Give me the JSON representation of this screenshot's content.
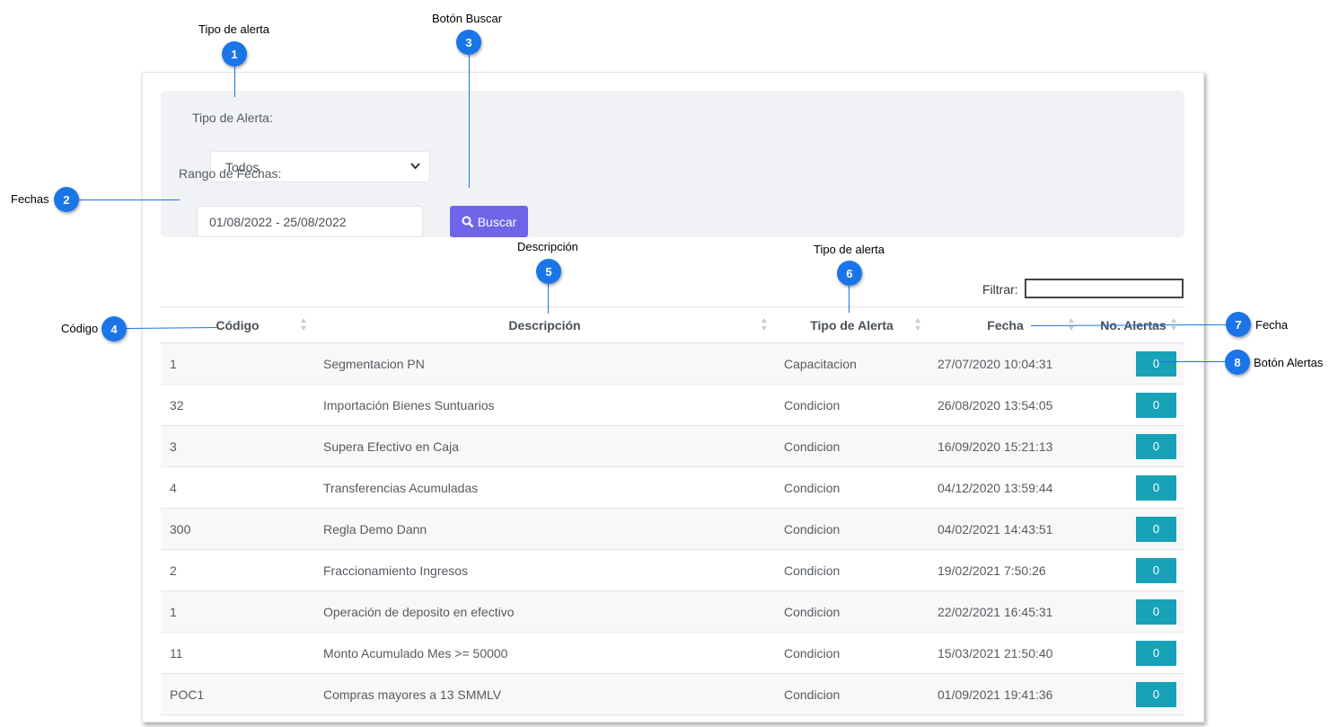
{
  "filters": {
    "tipo_label": "Tipo de Alerta:",
    "tipo_value": "Todos",
    "rango_label": "Rango de Fechas:",
    "rango_value": "01/08/2022 - 25/08/2022",
    "buscar_label": "Buscar",
    "filtrar_label": "Filtrar:"
  },
  "table": {
    "headers": [
      "Código",
      "Descripción",
      "Tipo de Alerta",
      "Fecha",
      "No. Alertas"
    ],
    "rows": [
      {
        "codigo": "1",
        "descripcion": "Segmentacion PN",
        "tipo": "Capacitacion",
        "fecha": "27/07/2020 10:04:31",
        "alertas": "0"
      },
      {
        "codigo": "32",
        "descripcion": "Importación Bienes Suntuarios",
        "tipo": "Condicion",
        "fecha": "26/08/2020 13:54:05",
        "alertas": "0"
      },
      {
        "codigo": "3",
        "descripcion": "Supera Efectivo en Caja",
        "tipo": "Condicion",
        "fecha": "16/09/2020 15:21:13",
        "alertas": "0"
      },
      {
        "codigo": "4",
        "descripcion": "Transferencias Acumuladas",
        "tipo": "Condicion",
        "fecha": "04/12/2020 13:59:44",
        "alertas": "0"
      },
      {
        "codigo": "300",
        "descripcion": "Regla Demo Dann",
        "tipo": "Condicion",
        "fecha": "04/02/2021 14:43:51",
        "alertas": "0"
      },
      {
        "codigo": "2",
        "descripcion": "Fraccionamiento Ingresos",
        "tipo": "Condicion",
        "fecha": "19/02/2021 7:50:26",
        "alertas": "0"
      },
      {
        "codigo": "1",
        "descripcion": "Operación de deposito en efectivo",
        "tipo": "Condicion",
        "fecha": "22/02/2021 16:45:31",
        "alertas": "0"
      },
      {
        "codigo": "11",
        "descripcion": "Monto Acumulado Mes >= 50000",
        "tipo": "Condicion",
        "fecha": "15/03/2021 21:50:40",
        "alertas": "0"
      },
      {
        "codigo": "POC1",
        "descripcion": "Compras mayores a 13 SMMLV",
        "tipo": "Condicion",
        "fecha": "01/09/2021 19:41:36",
        "alertas": "0"
      }
    ]
  },
  "annotations": [
    {
      "num": "1",
      "label": "Tipo de alerta"
    },
    {
      "num": "2",
      "label": "Fechas"
    },
    {
      "num": "3",
      "label": "Botón  Buscar"
    },
    {
      "num": "4",
      "label": "Código"
    },
    {
      "num": "5",
      "label": "Descripción"
    },
    {
      "num": "6",
      "label": "Tipo de alerta"
    },
    {
      "num": "7",
      "label": "Fecha"
    },
    {
      "num": "8",
      "label": "Botón Alertas"
    }
  ],
  "colors": {
    "accent": "#7065e8",
    "info": "#17a2b8",
    "callout": "#1a75e8"
  }
}
